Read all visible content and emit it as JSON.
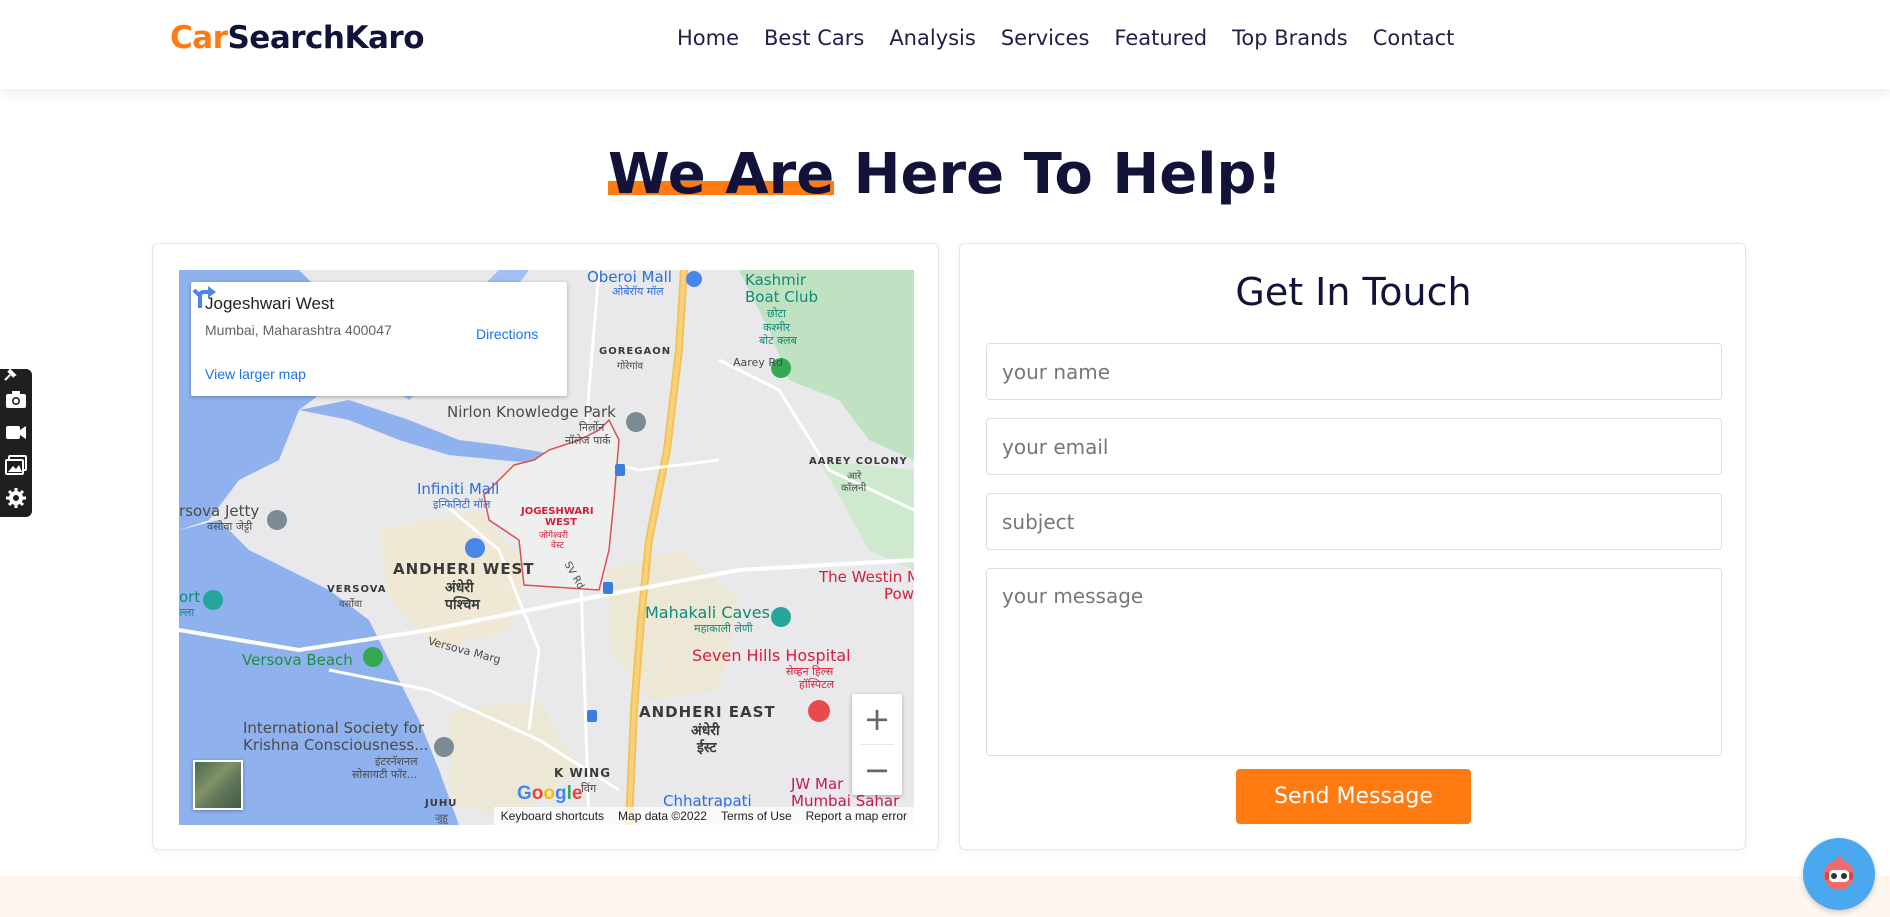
{
  "header": {
    "logo_part1": "Car",
    "logo_part2": "SearchKaro",
    "nav": [
      "Home",
      "Best Cars",
      "Analysis",
      "Services",
      "Featured",
      "Top Brands",
      "Contact"
    ]
  },
  "hero": {
    "title_highlight": "We Are",
    "title_rest": " Here To Help!"
  },
  "colors": {
    "accent": "#ff7a10",
    "navy": "#13133a",
    "chat": "#4aa8ee"
  },
  "map": {
    "place_title": "Jogeshwari West",
    "address": "Mumbai, Maharashtra 400047",
    "directions_label": "Directions",
    "view_larger_label": "View larger map",
    "zoom_in": "+",
    "zoom_out": "−",
    "google_letters": [
      "G",
      "o",
      "o",
      "g",
      "l",
      "e"
    ],
    "attribution": [
      "Keyboard shortcuts",
      "Map data ©2022",
      "Terms of Use",
      "Report a map error"
    ],
    "labels": {
      "oberoi": "Oberoi Mall",
      "oberoi_hi": "ओबेरॉय मॉल",
      "kashmir1": "Kashmir",
      "kashmir2": "Boat Club",
      "kashmir_hi1": "छोटा",
      "kashmir_hi2": "कश्मीर",
      "kashmir_hi3": "बोट क्लब",
      "goregaon": "GOREGAON",
      "goregaon_hi": "गोरेगांव",
      "aarey_rd": "Aarey Rd",
      "nirlon": "Nirlon Knowledge Park",
      "nirlon_hi1": "निर्लोन",
      "nirlon_hi2": "नॉलेज पार्क",
      "aarey_colony": "AAREY COLONY",
      "aarey_colony_hi1": "आरे",
      "aarey_colony_hi2": "कॉलनी",
      "infiniti": "Infiniti Mall",
      "infiniti_hi": "इन्फिनिटी मॉल",
      "versova_jetty": "rsova Jetty",
      "versova_jetty_hi": "वसोवा जेट्टी",
      "jogeshwari1": "JOGESHWARI",
      "jogeshwari2": "WEST",
      "jogeshwari_hi1": "जोगेश्वरी",
      "jogeshwari_hi2": "वेस्ट",
      "sv_rd": "SV Rd",
      "andheri_west": "ANDHERI WEST",
      "andheri_west_hi1": "अंधेरी",
      "andheri_west_hi2": "पश्चिम",
      "versova": "VERSOVA",
      "versova_hi": "वर्सोवा",
      "ort": "ort",
      "ort_hi": "ल्ला",
      "westin1": "The Westin M",
      "westin2": "Pow",
      "mahakali": "Mahakali Caves",
      "mahakali_hi": "महाकाली लेणी",
      "versova_marg": "Versova Marg",
      "versova_beach": "Versova Beach",
      "seven_hills": "Seven Hills Hospital",
      "seven_hills_hi1": "सेव्हन हिल्स",
      "seven_hills_hi2": "हॉस्पिटल",
      "andheri_east": "ANDHERI EAST",
      "andheri_east_hi1": "अंधेरी",
      "andheri_east_hi2": "ईस्ट",
      "iskcon1": "International Society for",
      "iskcon2": "Krishna Consciousness...",
      "iskcon_hi1": "इंटरनॅशनल",
      "iskcon_hi2": "सोसायटी फॉर...",
      "kwing": "K WING",
      "kwing_hi": "विंग",
      "jw1": "JW Mar",
      "jw2": "Mumbai Sahar",
      "juhu": "JUHU",
      "juhu_hi": "जुहू",
      "chhatrapati": "Chhatrapati"
    }
  },
  "form": {
    "title": "Get In Touch",
    "name_placeholder": "your name",
    "email_placeholder": "your email",
    "subject_placeholder": "subject",
    "message_placeholder": "your message",
    "submit_label": "Send Message"
  },
  "toolbar_icons": [
    "pin-icon",
    "camera-icon",
    "video-icon",
    "gallery-icon",
    "gear-icon"
  ]
}
